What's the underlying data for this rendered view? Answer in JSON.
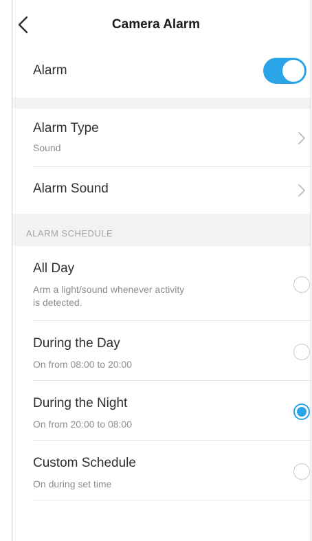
{
  "header": {
    "title": "Camera Alarm",
    "back_icon": "chevron-left-icon"
  },
  "alarm": {
    "label": "Alarm",
    "enabled": true,
    "toggle_color": "#29a4e6"
  },
  "settings": {
    "alarm_type": {
      "label": "Alarm Type",
      "value": "Sound"
    },
    "alarm_sound": {
      "label": "Alarm Sound"
    }
  },
  "schedule": {
    "section_title": "ALARM SCHEDULE",
    "selected": "during_the_night",
    "options": [
      {
        "title": "All Day",
        "description_line1": "Arm a light/sound whenever activity",
        "description_line2": "is detected.",
        "selected": false
      },
      {
        "title": "During the Day",
        "description_line1": "On from 08:00 to 20:00",
        "selected": false
      },
      {
        "title": "During the Night",
        "description_line1": "On from 20:00 to 08:00",
        "selected": true
      },
      {
        "title": "Custom Schedule",
        "description_line1": "On during set time",
        "selected": false
      }
    ]
  }
}
